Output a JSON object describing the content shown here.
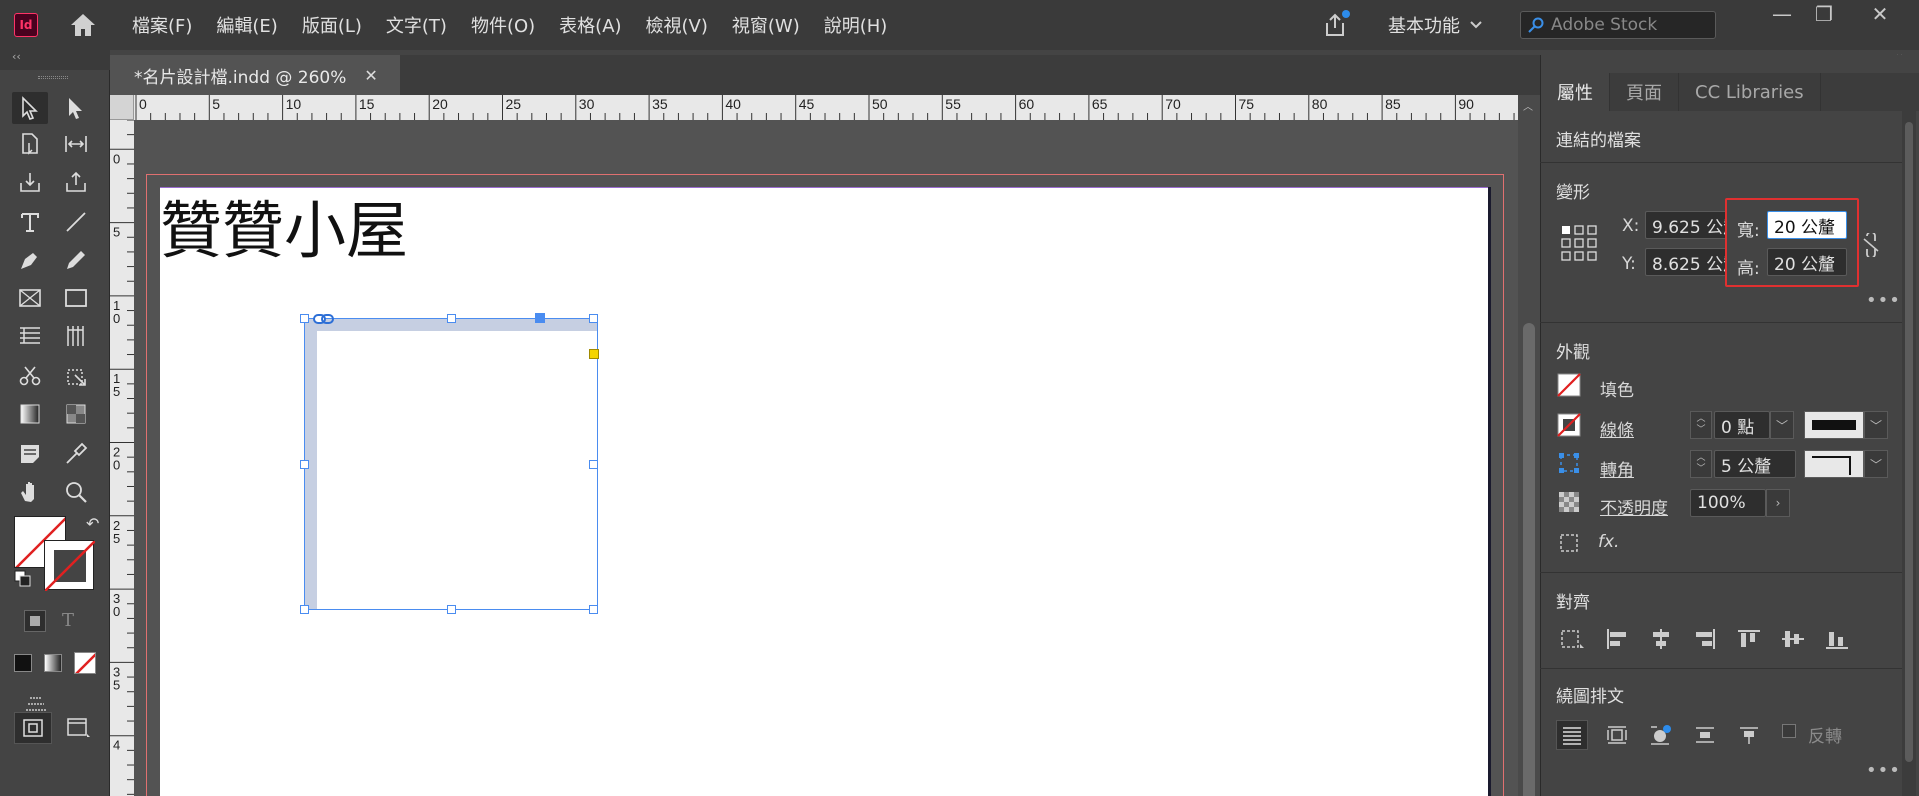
{
  "app": {
    "logo_label": "Id"
  },
  "menu": {
    "items": [
      "檔案(F)",
      "編輯(E)",
      "版面(L)",
      "文字(T)",
      "物件(O)",
      "表格(A)",
      "檢視(V)",
      "視窗(W)",
      "說明(H)"
    ]
  },
  "workspace": {
    "label": "基本功能"
  },
  "search": {
    "placeholder": "Adobe Stock"
  },
  "strip": {
    "left_arrows": "‹‹",
    "right_arrows": "››"
  },
  "document": {
    "tab_title": "*名片設計檔.indd @ 260%",
    "close_label": "✕",
    "heading_text": "贊贊小屋"
  },
  "ruler": {
    "h_labels": [
      "0",
      "5",
      "10",
      "15",
      "20",
      "25",
      "30",
      "35",
      "40",
      "45",
      "50",
      "55",
      "60",
      "65",
      "70",
      "75",
      "80",
      "85",
      "90"
    ],
    "v_labels": [
      "5",
      "0",
      "5",
      "1 0",
      "1 5",
      "2 0",
      "2 5",
      "3 0",
      "3 5",
      "4"
    ]
  },
  "panel": {
    "tabs": [
      "屬性",
      "頁面",
      "CC Libraries"
    ],
    "linked_file": "連結的檔案",
    "transform": {
      "title": "變形",
      "x_label": "X:",
      "x_value": "9.625 公釐",
      "y_label": "Y:",
      "y_value": "8.625 公釐",
      "w_label": "寬:",
      "w_value": "20 公釐",
      "h_label": "高:",
      "h_value": "20 公釐"
    },
    "appearance": {
      "title": "外觀",
      "fill_label": "填色",
      "stroke_label": "線條",
      "stroke_value": "0 點",
      "corner_label": "轉角",
      "corner_value": "5 公釐",
      "opacity_label": "不透明度",
      "opacity_value": "100%",
      "fx_label": "fx."
    },
    "align": {
      "title": "對齊"
    },
    "wrap": {
      "title": "繞圖排文",
      "invert_label": "反轉"
    },
    "more": "•••"
  },
  "colors": {
    "highlight": "#e03030",
    "selection": "#4a8cf0",
    "logo": "#ff3366"
  }
}
